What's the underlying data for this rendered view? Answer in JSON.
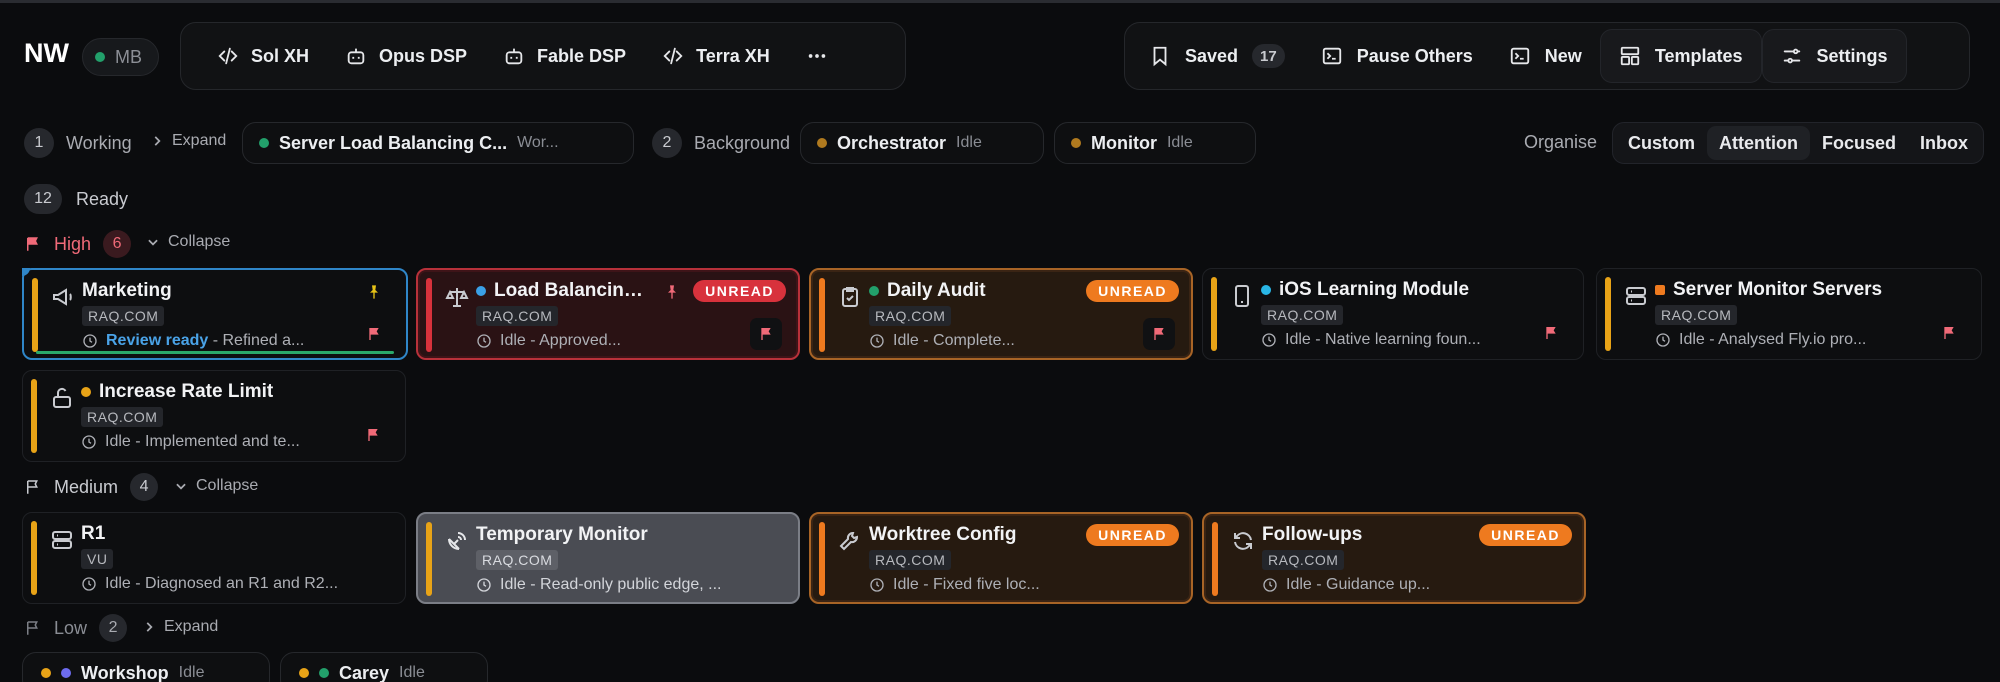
{
  "header": {
    "logo": "NW",
    "badge": "MB",
    "agents": [
      {
        "label": "Sol XH",
        "icon": "code-icon"
      },
      {
        "label": "Opus DSP",
        "icon": "robot-icon"
      },
      {
        "label": "Fable DSP",
        "icon": "robot-icon"
      },
      {
        "label": "Terra XH",
        "icon": "code-icon"
      }
    ],
    "saved_label": "Saved",
    "saved_count": "17",
    "pause_label": "Pause Others",
    "new_label": "New",
    "templates_label": "Templates",
    "settings_label": "Settings"
  },
  "status_row": {
    "working_count": "1",
    "working_label": "Working",
    "expand_label": "Expand",
    "working_session_title": "Server Load Balancing C...",
    "working_session_status": "Wor...",
    "background_count": "2",
    "background_label": "Background",
    "background_sessions": [
      {
        "title": "Orchestrator",
        "status": "Idle"
      },
      {
        "title": "Monitor",
        "status": "Idle"
      }
    ],
    "organise_label": "Organise",
    "organise_options": [
      "Custom",
      "Attention",
      "Focused",
      "Inbox"
    ],
    "organise_selected": "Attention",
    "ready_count": "12",
    "ready_label": "Ready"
  },
  "groups": {
    "high": {
      "label": "High",
      "count": "6",
      "toggle": "Collapse"
    },
    "medium": {
      "label": "Medium",
      "count": "4",
      "toggle": "Collapse"
    },
    "low": {
      "label": "Low",
      "count": "2",
      "toggle": "Expand"
    }
  },
  "cards": [
    {
      "title": "Marketing",
      "org": "RAQ.COM",
      "status_strong": "Review ready",
      "status": " - Refined a..."
    },
    {
      "title": "Load Balancing ...",
      "org": "RAQ.COM",
      "status": "Idle - Approved...",
      "badge": "UNREAD"
    },
    {
      "title": "Daily Audit",
      "org": "RAQ.COM",
      "status": "Idle - Complete...",
      "badge": "UNREAD"
    },
    {
      "title": "iOS Learning Module",
      "org": "RAQ.COM",
      "status": "Idle - Native learning foun..."
    },
    {
      "title": "Server Monitor Servers",
      "org": "RAQ.COM",
      "status": "Idle - Analysed Fly.io pro..."
    },
    {
      "title": "Increase Rate Limit",
      "org": "RAQ.COM",
      "status": "Idle - Implemented and te..."
    },
    {
      "title": "R1",
      "org": "VU",
      "status": "Idle - Diagnosed an R1 and R2..."
    },
    {
      "title": "Temporary Monitor",
      "org": "RAQ.COM",
      "status": "Idle - Read-only public edge, ..."
    },
    {
      "title": "Worktree Config",
      "org": "RAQ.COM",
      "status": "Idle - Fixed five loc...",
      "badge": "UNREAD"
    },
    {
      "title": "Follow-ups",
      "org": "RAQ.COM",
      "status": "Idle - Guidance up...",
      "badge": "UNREAD"
    }
  ],
  "low_sessions": [
    {
      "title": "Workshop",
      "status": "Idle"
    },
    {
      "title": "Carey",
      "status": "Idle"
    }
  ],
  "colors": {
    "accent_blue": "#2f86c8",
    "unread_red": "#d8323c",
    "unread_orange": "#ee7a1f",
    "priority_bar": "#e8a317",
    "flag_red": "#f06a78",
    "status_green": "#22a06b"
  }
}
